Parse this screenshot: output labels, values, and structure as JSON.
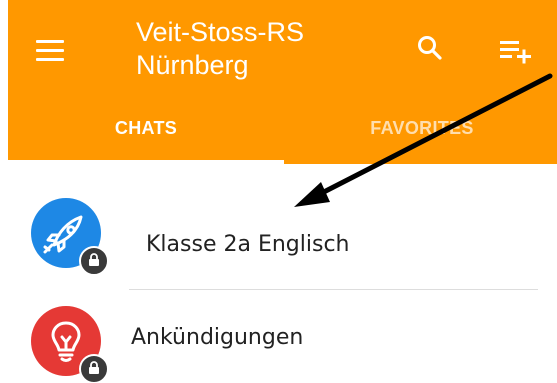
{
  "appbar": {
    "title_line1": "Veit-Stoss-RS",
    "title_line2": "Nürnberg",
    "menu_icon": "hamburger-menu-icon",
    "search_icon": "search-icon",
    "new_chat_icon": "playlist-add-icon",
    "background_color": "#FF9800"
  },
  "tabs": [
    {
      "label": "CHATS",
      "active": true
    },
    {
      "label": "FAVORITES",
      "active": false
    }
  ],
  "chats": [
    {
      "name": "Klasse 2a Englisch",
      "icon": "rocket-icon",
      "avatar_color": "#1E88E5",
      "locked": true
    },
    {
      "name": "Ankündigungen",
      "icon": "lightbulb-icon",
      "avatar_color": "#E53935",
      "locked": true
    }
  ],
  "annotation": {
    "type": "arrow",
    "color": "#000000",
    "target": "chat-item-klasse-2a-englisch"
  }
}
